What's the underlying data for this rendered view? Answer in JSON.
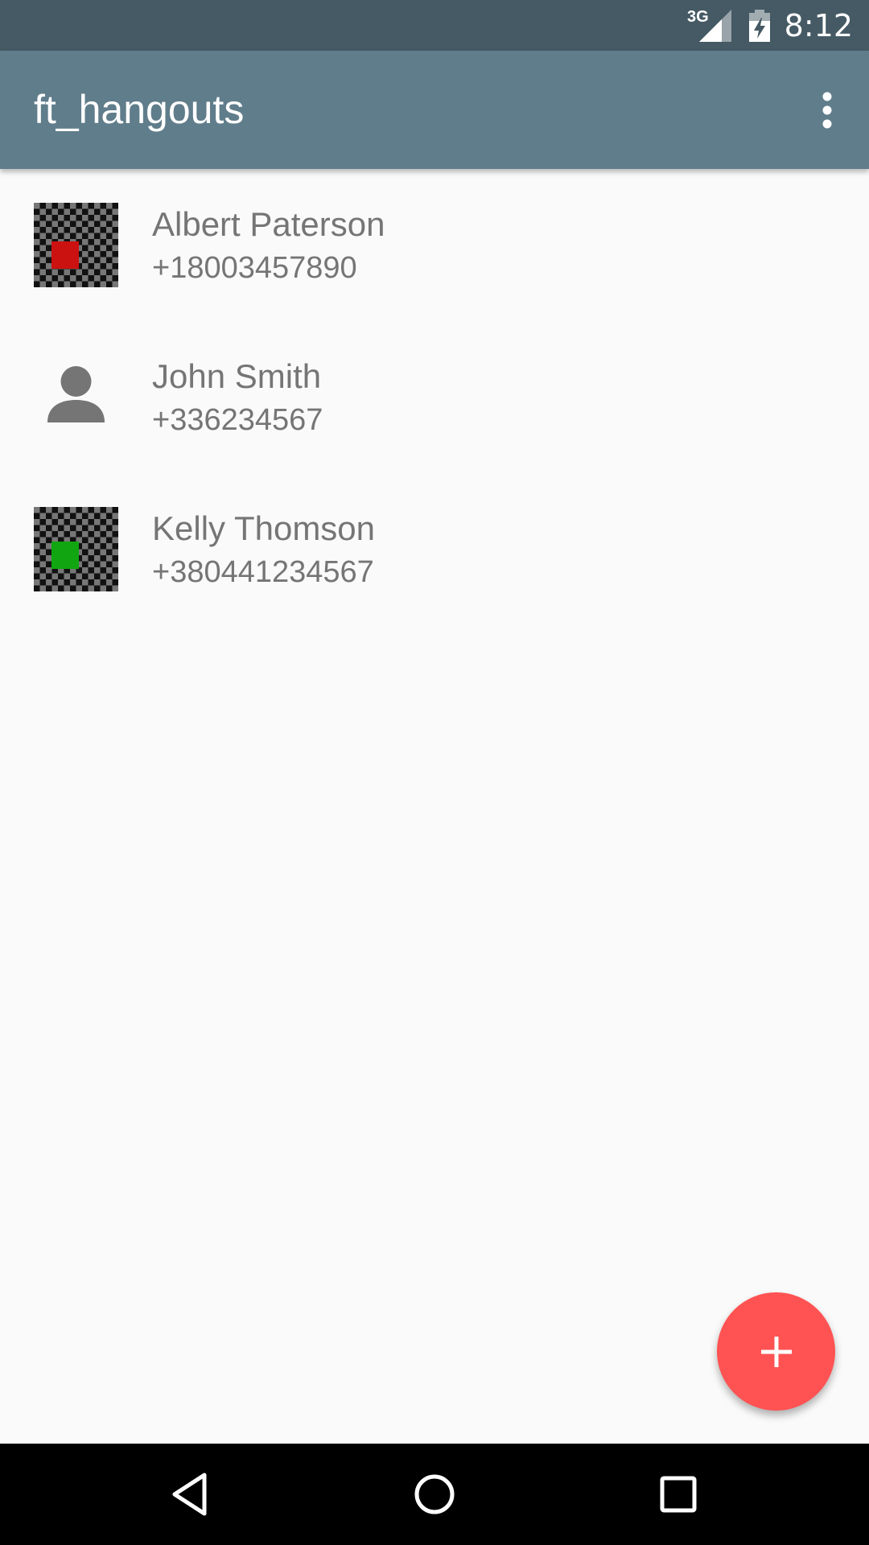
{
  "status_bar": {
    "network_type": "3G",
    "time": "8:12",
    "icons": [
      "signal-icon",
      "battery-charging-icon"
    ]
  },
  "app_bar": {
    "title": "ft_hangouts",
    "overflow_icon": "more-vert-icon"
  },
  "contacts": [
    {
      "name": "Albert Paterson",
      "phone": "+18003457890",
      "avatar": "checker-red",
      "accent": "#cc1111"
    },
    {
      "name": "John Smith",
      "phone": "+336234567",
      "avatar": "default-person",
      "accent": "#757575"
    },
    {
      "name": "Kelly Thomson",
      "phone": "+380441234567",
      "avatar": "checker-green",
      "accent": "#11a611"
    }
  ],
  "fab": {
    "icon": "plus-icon",
    "color": "#ff5252"
  },
  "nav_bar": {
    "buttons": [
      "back-icon",
      "home-icon",
      "recents-icon"
    ]
  },
  "colors": {
    "status_bar": "#455a64",
    "app_bar": "#607d8b",
    "background": "#fafafa",
    "text_secondary": "#757575"
  }
}
